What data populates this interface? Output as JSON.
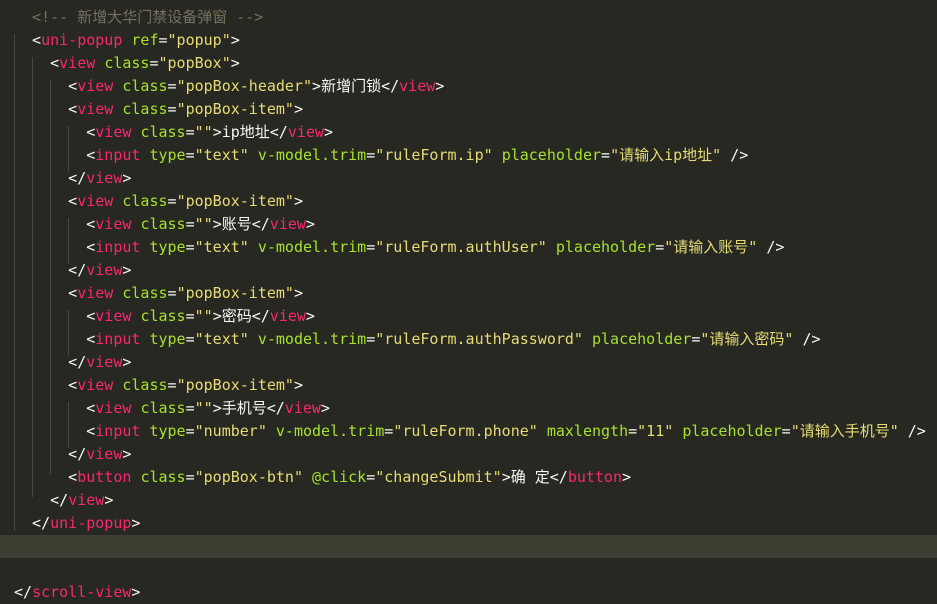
{
  "editor": {
    "lines": [
      [
        [
          "cm",
          "  <!-- 新增大华门禁设备弹窗 -->"
        ]
      ],
      [
        [
          "pn",
          "  <"
        ],
        [
          "tg",
          "uni-popup"
        ],
        [
          "pn",
          " "
        ],
        [
          "at",
          "ref"
        ],
        [
          "pn",
          "="
        ],
        [
          "st",
          "\"popup\""
        ],
        [
          "pn",
          ">"
        ]
      ],
      [
        [
          "pn",
          "    <"
        ],
        [
          "tg",
          "view"
        ],
        [
          "pn",
          " "
        ],
        [
          "at",
          "class"
        ],
        [
          "pn",
          "="
        ],
        [
          "st",
          "\"popBox\""
        ],
        [
          "pn",
          ">"
        ]
      ],
      [
        [
          "pn",
          "      <"
        ],
        [
          "tg",
          "view"
        ],
        [
          "pn",
          " "
        ],
        [
          "at",
          "class"
        ],
        [
          "pn",
          "="
        ],
        [
          "st",
          "\"popBox-header\""
        ],
        [
          "pn",
          ">"
        ],
        [
          "tx",
          "新增门锁"
        ],
        [
          "pn",
          "</"
        ],
        [
          "tg",
          "view"
        ],
        [
          "pn",
          ">"
        ]
      ],
      [
        [
          "pn",
          "      <"
        ],
        [
          "tg",
          "view"
        ],
        [
          "pn",
          " "
        ],
        [
          "at",
          "class"
        ],
        [
          "pn",
          "="
        ],
        [
          "st",
          "\"popBox-item\""
        ],
        [
          "pn",
          ">"
        ]
      ],
      [
        [
          "pn",
          "        <"
        ],
        [
          "tg",
          "view"
        ],
        [
          "pn",
          " "
        ],
        [
          "at",
          "class"
        ],
        [
          "pn",
          "="
        ],
        [
          "st",
          "\"\""
        ],
        [
          "pn",
          ">"
        ],
        [
          "tx",
          "ip地址"
        ],
        [
          "pn",
          "</"
        ],
        [
          "tg",
          "view"
        ],
        [
          "pn",
          ">"
        ]
      ],
      [
        [
          "pn",
          "        <"
        ],
        [
          "tg",
          "input"
        ],
        [
          "pn",
          " "
        ],
        [
          "at",
          "type"
        ],
        [
          "pn",
          "="
        ],
        [
          "st",
          "\"text\""
        ],
        [
          "pn",
          " "
        ],
        [
          "at",
          "v-model.trim"
        ],
        [
          "pn",
          "="
        ],
        [
          "st",
          "\"ruleForm.ip\""
        ],
        [
          "pn",
          " "
        ],
        [
          "at",
          "placeholder"
        ],
        [
          "pn",
          "="
        ],
        [
          "st",
          "\"请输入ip地址\""
        ],
        [
          "pn",
          " />"
        ]
      ],
      [
        [
          "pn",
          "      </"
        ],
        [
          "tg",
          "view"
        ],
        [
          "pn",
          ">"
        ]
      ],
      [
        [
          "pn",
          "      <"
        ],
        [
          "tg",
          "view"
        ],
        [
          "pn",
          " "
        ],
        [
          "at",
          "class"
        ],
        [
          "pn",
          "="
        ],
        [
          "st",
          "\"popBox-item\""
        ],
        [
          "pn",
          ">"
        ]
      ],
      [
        [
          "pn",
          "        <"
        ],
        [
          "tg",
          "view"
        ],
        [
          "pn",
          " "
        ],
        [
          "at",
          "class"
        ],
        [
          "pn",
          "="
        ],
        [
          "st",
          "\"\""
        ],
        [
          "pn",
          ">"
        ],
        [
          "tx",
          "账号"
        ],
        [
          "pn",
          "</"
        ],
        [
          "tg",
          "view"
        ],
        [
          "pn",
          ">"
        ]
      ],
      [
        [
          "pn",
          "        <"
        ],
        [
          "tg",
          "input"
        ],
        [
          "pn",
          " "
        ],
        [
          "at",
          "type"
        ],
        [
          "pn",
          "="
        ],
        [
          "st",
          "\"text\""
        ],
        [
          "pn",
          " "
        ],
        [
          "at",
          "v-model.trim"
        ],
        [
          "pn",
          "="
        ],
        [
          "st",
          "\"ruleForm.authUser\""
        ],
        [
          "pn",
          " "
        ],
        [
          "at",
          "placeholder"
        ],
        [
          "pn",
          "="
        ],
        [
          "st",
          "\"请输入账号\""
        ],
        [
          "pn",
          " />"
        ]
      ],
      [
        [
          "pn",
          "      </"
        ],
        [
          "tg",
          "view"
        ],
        [
          "pn",
          ">"
        ]
      ],
      [
        [
          "pn",
          "      <"
        ],
        [
          "tg",
          "view"
        ],
        [
          "pn",
          " "
        ],
        [
          "at",
          "class"
        ],
        [
          "pn",
          "="
        ],
        [
          "st",
          "\"popBox-item\""
        ],
        [
          "pn",
          ">"
        ]
      ],
      [
        [
          "pn",
          "        <"
        ],
        [
          "tg",
          "view"
        ],
        [
          "pn",
          " "
        ],
        [
          "at",
          "class"
        ],
        [
          "pn",
          "="
        ],
        [
          "st",
          "\"\""
        ],
        [
          "pn",
          ">"
        ],
        [
          "tx",
          "密码"
        ],
        [
          "pn",
          "</"
        ],
        [
          "tg",
          "view"
        ],
        [
          "pn",
          ">"
        ]
      ],
      [
        [
          "pn",
          "        <"
        ],
        [
          "tg",
          "input"
        ],
        [
          "pn",
          " "
        ],
        [
          "at",
          "type"
        ],
        [
          "pn",
          "="
        ],
        [
          "st",
          "\"text\""
        ],
        [
          "pn",
          " "
        ],
        [
          "at",
          "v-model.trim"
        ],
        [
          "pn",
          "="
        ],
        [
          "st",
          "\"ruleForm.authPassword\""
        ],
        [
          "pn",
          " "
        ],
        [
          "at",
          "placeholder"
        ],
        [
          "pn",
          "="
        ],
        [
          "st",
          "\"请输入密码\""
        ],
        [
          "pn",
          " />"
        ]
      ],
      [
        [
          "pn",
          "      </"
        ],
        [
          "tg",
          "view"
        ],
        [
          "pn",
          ">"
        ]
      ],
      [
        [
          "pn",
          "      <"
        ],
        [
          "tg",
          "view"
        ],
        [
          "pn",
          " "
        ],
        [
          "at",
          "class"
        ],
        [
          "pn",
          "="
        ],
        [
          "st",
          "\"popBox-item\""
        ],
        [
          "pn",
          ">"
        ]
      ],
      [
        [
          "pn",
          "        <"
        ],
        [
          "tg",
          "view"
        ],
        [
          "pn",
          " "
        ],
        [
          "at",
          "class"
        ],
        [
          "pn",
          "="
        ],
        [
          "st",
          "\"\""
        ],
        [
          "pn",
          ">"
        ],
        [
          "tx",
          "手机号"
        ],
        [
          "pn",
          "</"
        ],
        [
          "tg",
          "view"
        ],
        [
          "pn",
          ">"
        ]
      ],
      [
        [
          "pn",
          "        <"
        ],
        [
          "tg",
          "input"
        ],
        [
          "pn",
          " "
        ],
        [
          "at",
          "type"
        ],
        [
          "pn",
          "="
        ],
        [
          "st",
          "\"number\""
        ],
        [
          "pn",
          " "
        ],
        [
          "at",
          "v-model.trim"
        ],
        [
          "pn",
          "="
        ],
        [
          "st",
          "\"ruleForm.phone\""
        ],
        [
          "pn",
          " "
        ],
        [
          "at",
          "maxlength"
        ],
        [
          "pn",
          "="
        ],
        [
          "st",
          "\"11\""
        ],
        [
          "pn",
          " "
        ],
        [
          "at",
          "placeholder"
        ],
        [
          "pn",
          "="
        ],
        [
          "st",
          "\"请输入手机号\""
        ],
        [
          "pn",
          " />"
        ]
      ],
      [
        [
          "pn",
          "      </"
        ],
        [
          "tg",
          "view"
        ],
        [
          "pn",
          ">"
        ]
      ],
      [
        [
          "pn",
          "      <"
        ],
        [
          "tg",
          "button"
        ],
        [
          "pn",
          " "
        ],
        [
          "at",
          "class"
        ],
        [
          "pn",
          "="
        ],
        [
          "st",
          "\"popBox-btn\""
        ],
        [
          "pn",
          " "
        ],
        [
          "at",
          "@click"
        ],
        [
          "pn",
          "="
        ],
        [
          "st",
          "\"changeSubmit\""
        ],
        [
          "pn",
          ">"
        ],
        [
          "tx",
          "确 定"
        ],
        [
          "pn",
          "</"
        ],
        [
          "tg",
          "button"
        ],
        [
          "pn",
          ">"
        ]
      ],
      [
        [
          "pn",
          "    </"
        ],
        [
          "tg",
          "view"
        ],
        [
          "pn",
          ">"
        ]
      ],
      [
        [
          "pn",
          "  </"
        ],
        [
          "tg",
          "uni-popup"
        ],
        [
          "pn",
          ">"
        ]
      ],
      [],
      [],
      [
        [
          "pn",
          "</"
        ],
        [
          "tg",
          "scroll-view"
        ],
        [
          "pn",
          ">"
        ]
      ]
    ],
    "current_line": 23,
    "colors": {
      "background": "#272822",
      "current_line": "#3e3d32",
      "comment": "#75715e",
      "tag": "#f92672",
      "attribute": "#a6e22e",
      "string": "#e6db74",
      "text": "#f8f8f2"
    }
  }
}
